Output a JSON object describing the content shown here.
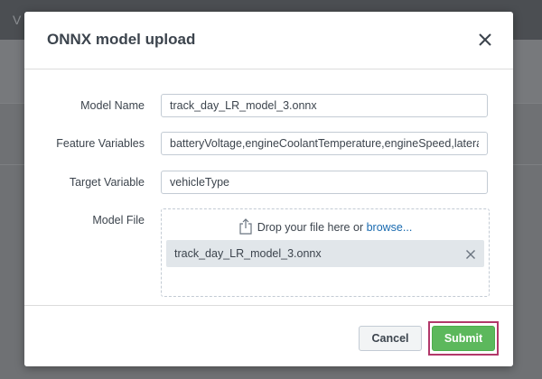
{
  "background": {
    "app_letter": "V"
  },
  "modal": {
    "title": "ONNX model upload",
    "close_icon": "close-icon",
    "fields": {
      "model_name": {
        "label": "Model Name",
        "value": "track_day_LR_model_3.onnx"
      },
      "feature_variables": {
        "label": "Feature Variables",
        "value": "batteryVoltage,engineCoolantTemperature,engineSpeed,latera"
      },
      "target_variable": {
        "label": "Target Variable",
        "value": "vehicleType"
      },
      "model_file": {
        "label": "Model File",
        "drop_text": "Drop your file here or",
        "browse_link": "browse...",
        "upload_icon": "upload-icon",
        "file_name": "track_day_LR_model_3.onnx",
        "remove_icon": "remove-file-icon"
      }
    },
    "footer": {
      "cancel_label": "Cancel",
      "submit_label": "Submit"
    }
  },
  "colors": {
    "submit": "#5cb85c",
    "submit_highlight": "#b2386a",
    "link": "#1a6bb0",
    "overlay": "#6f7174"
  }
}
